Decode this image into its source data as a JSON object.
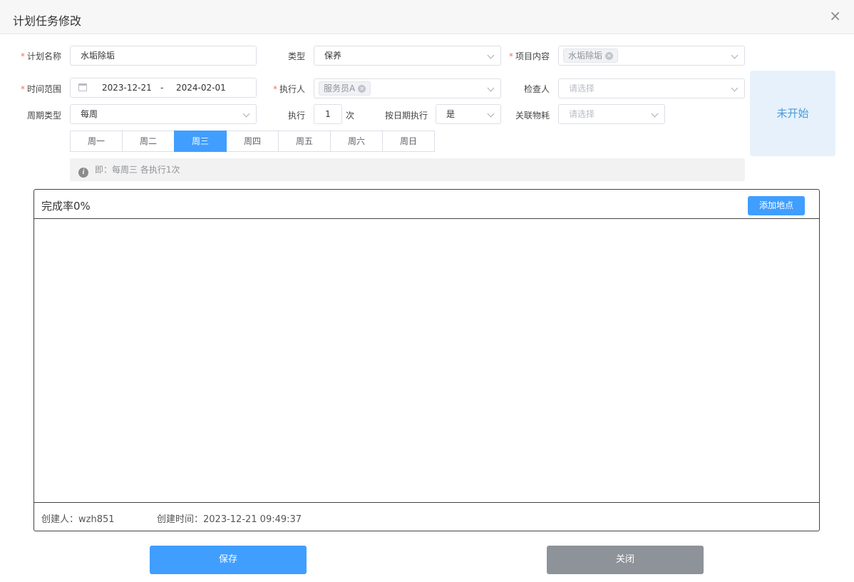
{
  "dialog": {
    "title": "计划任务修改",
    "close_glyph": "×"
  },
  "form": {
    "plan_name": {
      "label": "计划名称",
      "value": "水垢除垢"
    },
    "type": {
      "label": "类型",
      "value": "保养"
    },
    "item_content": {
      "label": "项目内容",
      "tag": "水垢除垢"
    },
    "time_range": {
      "label": "时间范围",
      "start": "2023-12-21",
      "separator": "-",
      "end": "2024-02-01"
    },
    "executor": {
      "label": "执行人",
      "tag": "服务员A"
    },
    "inspector": {
      "label": "检查人",
      "placeholder": "请选择"
    },
    "cycle_type": {
      "label": "周期类型",
      "value": "每周"
    },
    "execute": {
      "label": "执行",
      "count": "1",
      "unit": "次"
    },
    "by_date": {
      "label": "按日期执行",
      "value": "是"
    },
    "materials": {
      "label": "关联物耗",
      "placeholder": "请选择"
    },
    "required_mark": "*"
  },
  "status": {
    "label": "未开始"
  },
  "weekdays": [
    "周一",
    "周二",
    "周三",
    "周四",
    "周五",
    "周六",
    "周日"
  ],
  "selected_weekday": "周三",
  "hint": {
    "icon": "info-icon",
    "text": "即：每周三 各执行1次"
  },
  "panel": {
    "completion": "完成率0%",
    "add_button": "添加地点",
    "creator": "创建人：wzh851",
    "created_time": "创建时间：2023-12-21 09:49:37"
  },
  "actions": {
    "save": "保存",
    "close": "关闭"
  },
  "colors": {
    "primary": "#409eff",
    "required": "#f56c6c",
    "status_bg": "#e6f1fc",
    "close_button": "#8e9299"
  }
}
